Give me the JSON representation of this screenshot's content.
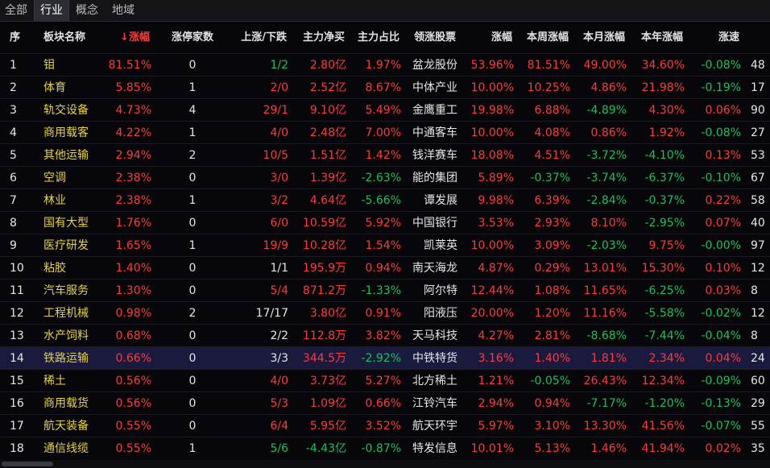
{
  "tabs": [
    "全部",
    "行业",
    "概念",
    "地域"
  ],
  "active_tab": 1,
  "headers": {
    "idx": "序",
    "name": "板块名称",
    "pct": "涨幅",
    "limit_up": "涨停家数",
    "updown": "上涨/下跌",
    "net_buy": "主力净买",
    "ratio": "主力占比",
    "leader": "领涨股票",
    "leader_pct": "涨幅",
    "week": "本周涨幅",
    "month": "本月涨幅",
    "year": "本年涨幅",
    "speed": "涨速"
  },
  "rows": [
    {
      "idx": "1",
      "name": "钼",
      "pct": "81.51%",
      "limit_up": "0",
      "updown": "1/2",
      "net_buy": "2.80亿",
      "ratio": "1.97%",
      "leader": "盆龙股份",
      "leader_pct": "53.96%",
      "week": "81.51%",
      "month": "49.00%",
      "year": "34.60%",
      "speed": "-0.08%",
      "extra": "48"
    },
    {
      "idx": "2",
      "name": "体育",
      "pct": "5.85%",
      "limit_up": "1",
      "updown": "2/0",
      "net_buy": "2.52亿",
      "ratio": "8.67%",
      "leader": "中体产业",
      "leader_pct": "10.00%",
      "week": "10.25%",
      "month": "4.86%",
      "year": "21.98%",
      "speed": "-0.19%",
      "extra": "17"
    },
    {
      "idx": "3",
      "name": "轨交设备",
      "pct": "4.73%",
      "limit_up": "4",
      "updown": "29/1",
      "net_buy": "9.10亿",
      "ratio": "5.49%",
      "leader": "金鹰重工",
      "leader_pct": "19.98%",
      "week": "6.88%",
      "month": "-4.89%",
      "year": "4.30%",
      "speed": "0.06%",
      "extra": "90"
    },
    {
      "idx": "4",
      "name": "商用载客",
      "pct": "4.22%",
      "limit_up": "1",
      "updown": "4/0",
      "net_buy": "2.48亿",
      "ratio": "7.00%",
      "leader": "中通客车",
      "leader_pct": "10.00%",
      "week": "4.08%",
      "month": "0.86%",
      "year": "1.92%",
      "speed": "-0.08%",
      "extra": "27"
    },
    {
      "idx": "5",
      "name": "其他运输",
      "pct": "2.94%",
      "limit_up": "2",
      "updown": "10/5",
      "net_buy": "1.51亿",
      "ratio": "1.42%",
      "leader": "钱洋赛车",
      "leader_pct": "18.08%",
      "week": "4.51%",
      "month": "-3.72%",
      "year": "-4.10%",
      "speed": "0.13%",
      "extra": "53"
    },
    {
      "idx": "6",
      "name": "空调",
      "pct": "2.38%",
      "limit_up": "0",
      "updown": "3/0",
      "net_buy": "1.39亿",
      "ratio": "-2.63%",
      "leader": "能的集团",
      "leader_pct": "5.89%",
      "week": "-0.37%",
      "month": "-3.74%",
      "year": "-6.37%",
      "speed": "-0.10%",
      "extra": "67"
    },
    {
      "idx": "7",
      "name": "林业",
      "pct": "2.38%",
      "limit_up": "1",
      "updown": "3/2",
      "net_buy": "4.64亿",
      "ratio": "-5.66%",
      "leader": "谭发展",
      "leader_pct": "9.98%",
      "week": "6.39%",
      "month": "-2.84%",
      "year": "-0.37%",
      "speed": "0.22%",
      "extra": "58"
    },
    {
      "idx": "8",
      "name": "国有大型",
      "pct": "1.76%",
      "limit_up": "0",
      "updown": "6/0",
      "net_buy": "10.59亿",
      "ratio": "5.92%",
      "leader": "中国银行",
      "leader_pct": "3.53%",
      "week": "2.93%",
      "month": "8.10%",
      "year": "-2.95%",
      "speed": "0.07%",
      "extra": "40"
    },
    {
      "idx": "9",
      "name": "医疗研发",
      "pct": "1.65%",
      "limit_up": "1",
      "updown": "19/9",
      "net_buy": "10.28亿",
      "ratio": "1.54%",
      "leader": "凯莱英",
      "leader_pct": "10.00%",
      "week": "3.09%",
      "month": "-2.03%",
      "year": "9.75%",
      "speed": "-0.00%",
      "extra": "97"
    },
    {
      "idx": "10",
      "name": "粘胶",
      "pct": "1.40%",
      "limit_up": "0",
      "updown": "1/1",
      "net_buy": "195.9万",
      "ratio": "0.94%",
      "leader": "南天海龙",
      "leader_pct": "4.87%",
      "week": "0.29%",
      "month": "13.01%",
      "year": "15.30%",
      "speed": "0.10%",
      "extra": "12"
    },
    {
      "idx": "11",
      "name": "汽车服务",
      "pct": "1.30%",
      "limit_up": "0",
      "updown": "5/4",
      "net_buy": "871.2万",
      "ratio": "-1.33%",
      "leader": "阿尔特",
      "leader_pct": "12.44%",
      "week": "1.08%",
      "month": "11.65%",
      "year": "-6.25%",
      "speed": "0.03%",
      "extra": "8"
    },
    {
      "idx": "12",
      "name": "工程机械",
      "pct": "0.98%",
      "limit_up": "2",
      "updown": "17/17",
      "net_buy": "3.80亿",
      "ratio": "0.91%",
      "leader": "阳液压",
      "leader_pct": "20.00%",
      "week": "1.20%",
      "month": "11.16%",
      "year": "-5.58%",
      "speed": "-0.02%",
      "extra": "12"
    },
    {
      "idx": "13",
      "name": "水产饲料",
      "pct": "0.68%",
      "limit_up": "0",
      "updown": "2/2",
      "net_buy": "112.8万",
      "ratio": "3.82%",
      "leader": "天马科技",
      "leader_pct": "4.27%",
      "week": "2.81%",
      "month": "-8.68%",
      "year": "-7.44%",
      "speed": "-0.04%",
      "extra": "8"
    },
    {
      "idx": "14",
      "name": "铁路运输",
      "pct": "0.66%",
      "limit_up": "0",
      "updown": "3/3",
      "net_buy": "344.5万",
      "ratio": "-2.92%",
      "leader": "中铁特货",
      "leader_pct": "3.16%",
      "week": "1.40%",
      "month": "1.81%",
      "year": "2.34%",
      "speed": "0.04%",
      "extra": "24"
    },
    {
      "idx": "15",
      "name": "稀土",
      "pct": "0.56%",
      "limit_up": "0",
      "updown": "4/0",
      "net_buy": "3.73亿",
      "ratio": "5.27%",
      "leader": "北方稀土",
      "leader_pct": "1.21%",
      "week": "-0.05%",
      "month": "26.43%",
      "year": "12.34%",
      "speed": "-0.09%",
      "extra": "60"
    },
    {
      "idx": "16",
      "name": "商用载货",
      "pct": "0.56%",
      "limit_up": "0",
      "updown": "5/3",
      "net_buy": "1.09亿",
      "ratio": "0.66%",
      "leader": "江铃汽车",
      "leader_pct": "2.94%",
      "week": "0.94%",
      "month": "-7.17%",
      "year": "-1.20%",
      "speed": "-0.13%",
      "extra": "29"
    },
    {
      "idx": "17",
      "name": "航天装备",
      "pct": "0.55%",
      "limit_up": "0",
      "updown": "6/4",
      "net_buy": "5.95亿",
      "ratio": "3.52%",
      "leader": "航天环宇",
      "leader_pct": "5.97%",
      "week": "3.10%",
      "month": "13.30%",
      "year": "41.56%",
      "speed": "-0.07%",
      "extra": "55"
    },
    {
      "idx": "18",
      "name": "通信线缆",
      "pct": "0.55%",
      "limit_up": "1",
      "updown": "5/6",
      "net_buy": "-4.43亿",
      "ratio": "-0.87%",
      "leader": "特发信息",
      "leader_pct": "10.01%",
      "week": "5.13%",
      "month": "1.46%",
      "year": "41.94%",
      "speed": "0.02%",
      "extra": "35"
    }
  ],
  "selected_row": 13,
  "colors": {
    "up": "#ff3a3a",
    "down": "#19c25a",
    "name": "#e8d24a",
    "selected_bg": "#1a1a3e"
  }
}
